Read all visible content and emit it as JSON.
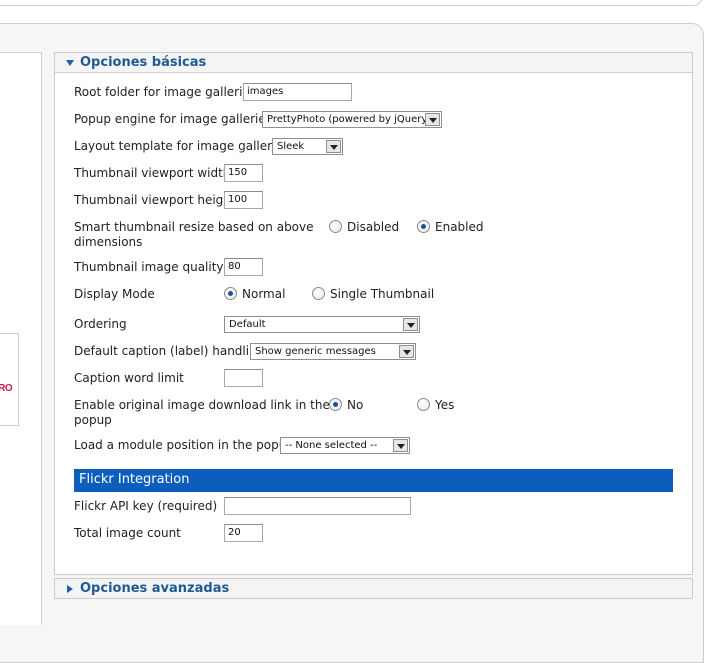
{
  "basic_section": {
    "title": "Opciones básicas",
    "fields": {
      "root_folder": {
        "label": "Root folder for image galleries",
        "value": "images"
      },
      "popup_engine": {
        "label": "Popup engine for image galleries",
        "selected": "PrettyPhoto (powered by jQuery)"
      },
      "layout_template": {
        "label": "Layout template for image galleries",
        "selected": "Sleek"
      },
      "thumb_width": {
        "label": "Thumbnail viewport width",
        "value": "150"
      },
      "thumb_height": {
        "label": "Thumbnail viewport height",
        "value": "100"
      },
      "smart_resize": {
        "label": "Smart thumbnail resize based on above dimensions",
        "label_line1": "Smart thumbnail resize based on above",
        "label_line2": "dimensions",
        "option1": "Disabled",
        "option2": "Enabled",
        "selected": "Enabled"
      },
      "thumb_quality": {
        "label": "Thumbnail image quality",
        "value": "80"
      },
      "display_mode": {
        "label": "Display Mode",
        "option1": "Normal",
        "option2": "Single Thumbnail",
        "selected": "Normal"
      },
      "ordering": {
        "label": "Ordering",
        "selected": "Default"
      },
      "caption_handling": {
        "label": "Default caption (label) handling",
        "selected": "Show generic messages"
      },
      "caption_limit": {
        "label": "Caption word limit",
        "value": ""
      },
      "download_link": {
        "label": "Enable original image download link in the popup",
        "label_line1": "Enable original image download link in the",
        "label_line2": "popup",
        "option1": "No",
        "option2": "Yes",
        "selected": "No"
      },
      "module_position": {
        "label": "Load a module position in the popup",
        "selected": "-- None selected --"
      }
    }
  },
  "flickr": {
    "title": "Flickr Integration",
    "api_key": {
      "label": "Flickr API key (required)",
      "value": ""
    },
    "image_count": {
      "label": "Total image count",
      "value": "20"
    }
  },
  "advanced_section": {
    "title": "Opciones avanzadas"
  },
  "left_panel": {
    "fragment_text": "PRO"
  },
  "colors": {
    "accent": "#1e5a93",
    "flickr_bar": "#0d5ebc",
    "radio_dot": "#1c4f9c"
  }
}
